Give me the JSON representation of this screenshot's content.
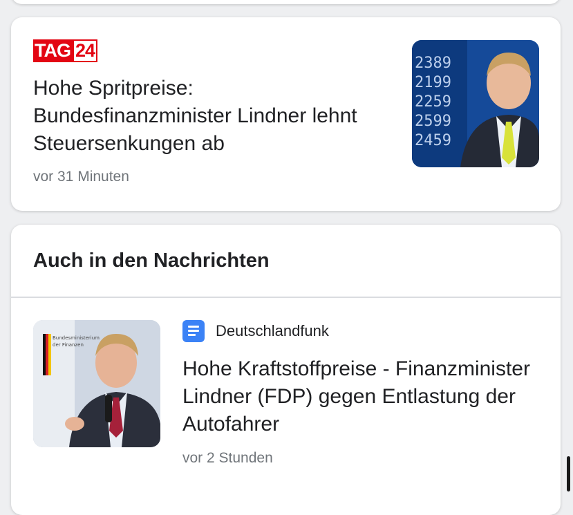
{
  "article": {
    "source_logo": {
      "tag": "TAG",
      "num": "24"
    },
    "title": "Hohe Spritpreise: Bundesfinanzminister Lindner lehnt Steuersenkungen ab",
    "time": "vor 31 Minuten",
    "thumbnail": {
      "price_board": [
        "2389",
        "2199",
        "2259",
        "2599",
        "2459"
      ]
    }
  },
  "news_section": {
    "heading": "Auch in den Nachrichten",
    "items": [
      {
        "source": "Deutschlandfunk",
        "source_icon": "document-icon",
        "title": "Hohe Kraftstoffpreise - Finanzminister Lindner (FDP) gegen Entlastung der Autofahrer",
        "time": "vor 2 Stunden",
        "thumbnail_sign": [
          "Bundesministerium",
          "der Finanzen"
        ]
      }
    ]
  },
  "colors": {
    "brand_red": "#e30613",
    "source_icon_blue": "#3b82f6",
    "text_primary": "#202124",
    "text_secondary": "#70757a"
  }
}
